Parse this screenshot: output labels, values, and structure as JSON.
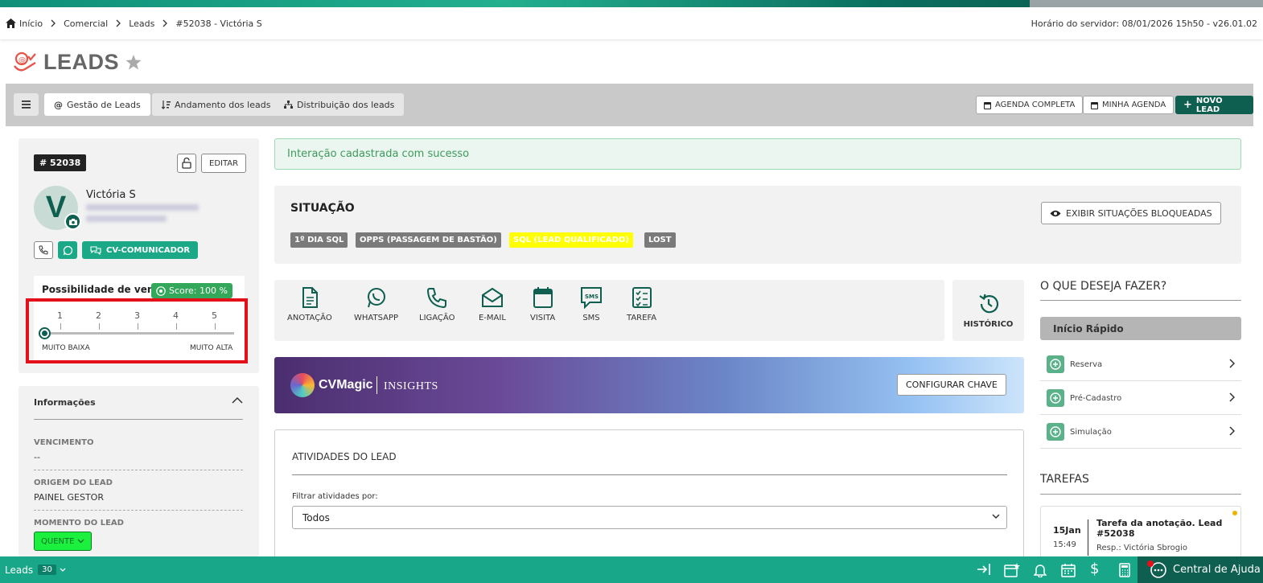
{
  "breadcrumb": {
    "items": [
      "Início",
      "Comercial",
      "Leads",
      "#52038 - Victória S"
    ],
    "server_time": "Horário do servidor: 08/01/2026 15h50 - v26.01.02"
  },
  "page": {
    "title": "LEADS"
  },
  "toolbar": {
    "tabs": [
      {
        "label": "Gestão de Leads",
        "active": true
      },
      {
        "label": "Andamento dos leads"
      },
      {
        "label": "Distribuição dos leads"
      }
    ],
    "agenda_completa": "AGENDA COMPLETA",
    "minha_agenda": "MINHA AGENDA",
    "novo_lead": "NOVO LEAD"
  },
  "lead": {
    "id": "# 52038",
    "edit_label": "EDITAR",
    "avatar_letter": "V",
    "name": "Victória S",
    "communicator_label": "CV-COMUNICADOR"
  },
  "possibility": {
    "label": "Possibilidade de venda",
    "score": "Score: 100 %",
    "scale": [
      "1",
      "2",
      "3",
      "4",
      "5"
    ],
    "selected": 0,
    "low_label": "MUITO BAIXA",
    "high_label": "MUITO ALTA"
  },
  "info": {
    "title": "Informações",
    "fields": [
      {
        "label": "VENCIMENTO",
        "value": "--"
      },
      {
        "label": "ORIGEM DO LEAD",
        "value": "PAINEL GESTOR"
      },
      {
        "label": "MOMENTO DO LEAD",
        "value": "QUENTE"
      }
    ]
  },
  "alert": {
    "message": "Interação cadastrada com sucesso"
  },
  "situacao": {
    "title": "SITUAÇÃO",
    "show_blocked_label": "EXIBIR SITUAÇÕES BLOQUEADAS",
    "badges": [
      {
        "label": "1º DIA SQL",
        "color": "#7a7a7a"
      },
      {
        "label": "OPPS (PASSAGEM DE BASTÃO)",
        "color": "#7a7a7a"
      },
      {
        "label": "SQL (LEAD QUALIFICADO)",
        "color": "#ffff00"
      },
      {
        "label": "LOST",
        "color": "#7a7a7a"
      }
    ]
  },
  "actions": [
    {
      "label": "ANOTAÇÃO",
      "icon": "file-icon"
    },
    {
      "label": "WHATSAPP",
      "icon": "whatsapp-icon"
    },
    {
      "label": "LIGAÇÃO",
      "icon": "phone-icon"
    },
    {
      "label": "E-MAIL",
      "icon": "envelope-icon"
    },
    {
      "label": "VISITA",
      "icon": "calendar-icon"
    },
    {
      "label": "SMS",
      "icon": "sms-icon"
    },
    {
      "label": "TAREFA",
      "icon": "checklist-icon"
    }
  ],
  "historico": {
    "label": "HISTÓRICO"
  },
  "cvmagic": {
    "brand": "CVMagic",
    "section": "INSIGHTS",
    "button": "CONFIGURAR CHAVE"
  },
  "atividades": {
    "title": "ATIVIDADES DO LEAD",
    "filter_label": "Filtrar atividades por:",
    "filter_value": "Todos"
  },
  "right": {
    "question": "O QUE DESEJA FAZER?",
    "quick_start": "Início Rápido",
    "items": [
      "Reserva",
      "Pré-Cadastro",
      "Simulação"
    ],
    "tasks_title": "TAREFAS",
    "task": {
      "date": "15Jan",
      "time": "15:49",
      "title": "Tarefa da anotação. Lead #52038",
      "resp": "Resp.: Victória Sbrogio"
    }
  },
  "bottombar": {
    "leads_label": "Leads",
    "count": "30",
    "help": "Central de Ajuda"
  },
  "colors": {
    "brand_dark": "#0e5f4f",
    "brand": "#18a889",
    "highlight_box": "#e3101a"
  }
}
